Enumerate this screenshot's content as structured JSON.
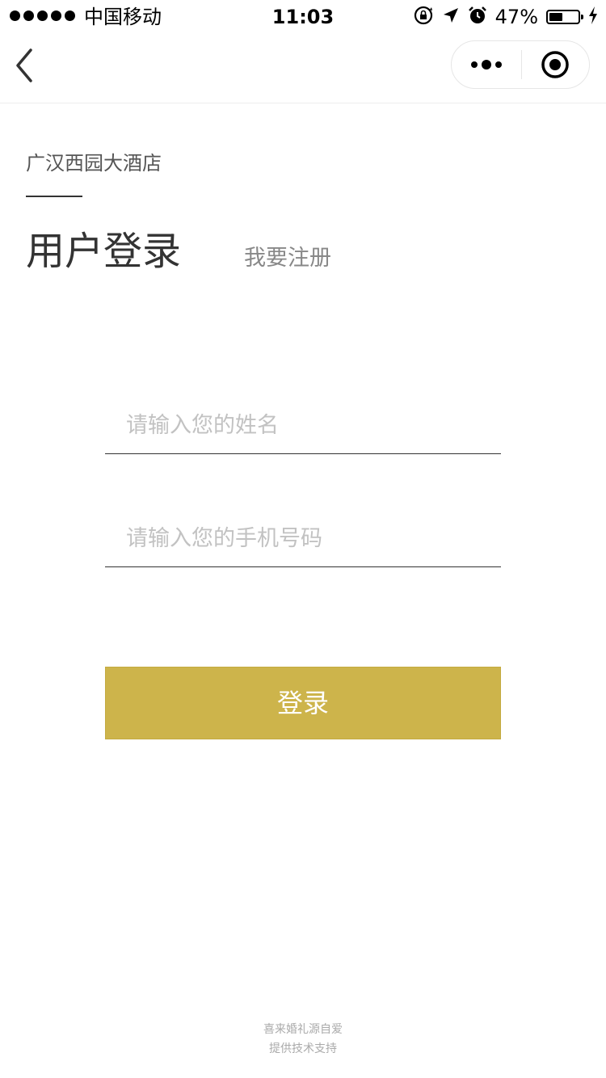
{
  "status_bar": {
    "carrier": "中国移动",
    "time": "11:03",
    "battery_percent": "47%",
    "battery_level": 0.47
  },
  "nav": {
    "back_icon": "chevron-left-icon",
    "more_icon": "more-dots-icon",
    "close_icon": "target-circle-icon"
  },
  "header": {
    "hotel_name": "广汉西园大酒店",
    "title": "用户登录",
    "register_link": "我要注册"
  },
  "form": {
    "name_placeholder": "请输入您的姓名",
    "name_value": "",
    "phone_placeholder": "请输入您的手机号码",
    "phone_value": "",
    "login_label": "登录"
  },
  "footer": {
    "line1": "喜来婚礼源自爱",
    "line2": "提供技术支持"
  },
  "colors": {
    "accent": "#cdb44b",
    "title_text": "#333333",
    "placeholder": "#c2c2c2",
    "footer_text": "#aaaaaa"
  }
}
